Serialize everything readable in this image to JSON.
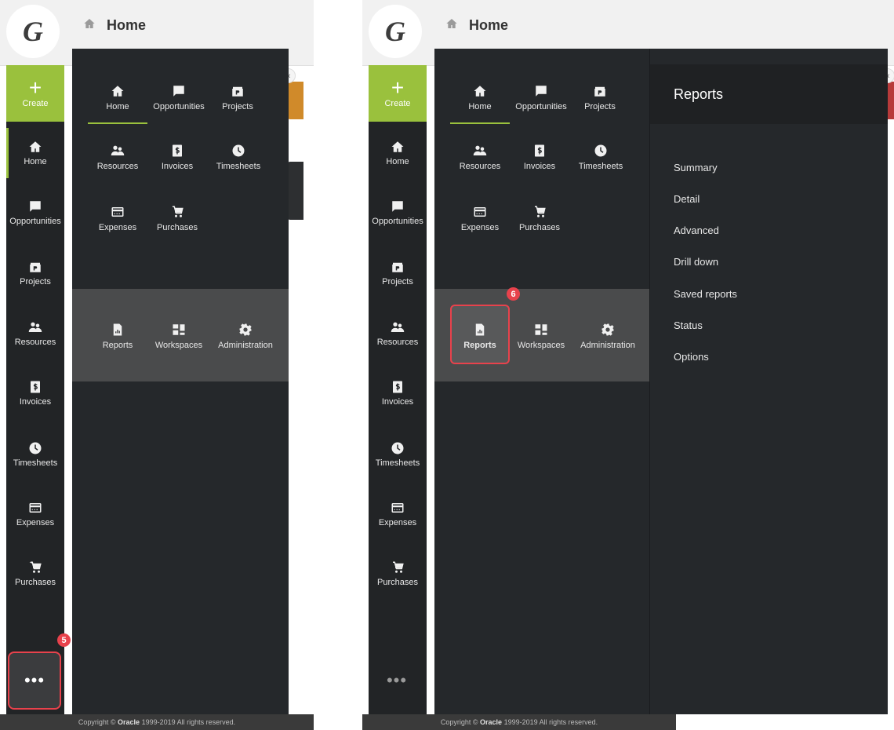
{
  "header": {
    "title": "Home"
  },
  "logo": {
    "letter": "G"
  },
  "rail": {
    "create_label": "Create",
    "items": [
      {
        "label": "Home",
        "icon": "home-icon"
      },
      {
        "label": "Opportunities",
        "icon": "chat-icon"
      },
      {
        "label": "Projects",
        "icon": "projects-icon"
      },
      {
        "label": "Resources",
        "icon": "people-icon"
      },
      {
        "label": "Invoices",
        "icon": "invoice-icon"
      },
      {
        "label": "Timesheets",
        "icon": "clock-icon"
      },
      {
        "label": "Expenses",
        "icon": "card-icon"
      },
      {
        "label": "Purchases",
        "icon": "cart-icon"
      }
    ],
    "more_label": "•••"
  },
  "flyout": {
    "top_items": [
      {
        "label": "Home"
      },
      {
        "label": "Opportunities"
      },
      {
        "label": "Projects"
      },
      {
        "label": "Resources"
      },
      {
        "label": "Invoices"
      },
      {
        "label": "Timesheets"
      },
      {
        "label": "Expenses"
      },
      {
        "label": "Purchases"
      }
    ],
    "bottom_items": [
      {
        "label": "Reports"
      },
      {
        "label": "Workspaces"
      },
      {
        "label": "Administration"
      }
    ]
  },
  "reports_panel": {
    "title": "Reports",
    "links": [
      "Summary",
      "Detail",
      "Advanced",
      "Drill down",
      "Saved reports",
      "Status",
      "Options"
    ]
  },
  "badges": {
    "step5": "5",
    "step6": "6"
  },
  "collapse_glyph": "«",
  "copyright": {
    "prefix": "Copyright ©",
    "brand": "Oracle",
    "suffix": "1999-2019 All rights reserved."
  },
  "colors": {
    "accent": "#9ac13d",
    "highlight": "#e8424c",
    "rail_bg": "#222426"
  }
}
